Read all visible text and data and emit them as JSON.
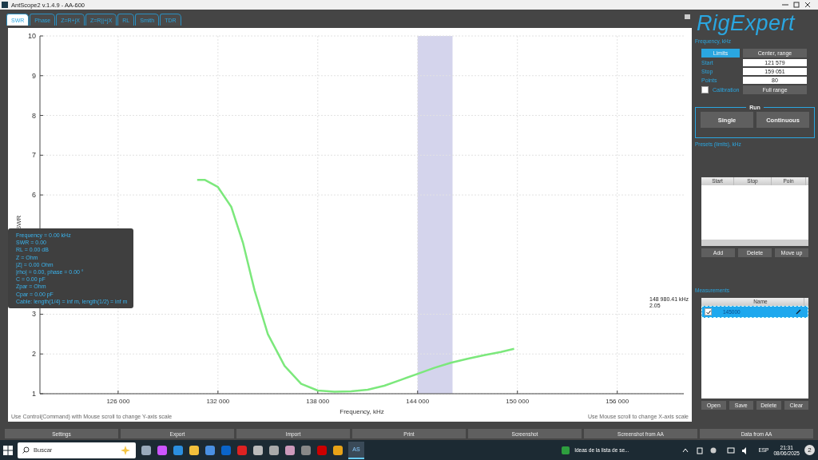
{
  "window": {
    "title": "AntScope2 v.1.4.9 - AA-600"
  },
  "tabs": [
    {
      "label": "SWR",
      "selected": true
    },
    {
      "label": "Phase",
      "selected": false
    },
    {
      "label": "Z=R+jX",
      "selected": false
    },
    {
      "label": "Z=R||+jX",
      "selected": false
    },
    {
      "label": "RL",
      "selected": false
    },
    {
      "label": "Smith",
      "selected": false
    },
    {
      "label": "TDR",
      "selected": false
    }
  ],
  "chart": {
    "chart_data": {
      "type": "line",
      "xlabel": "Frequency, kHz",
      "ylabel": "SWR",
      "xlim": [
        121300,
        160000
      ],
      "ylim": [
        1,
        10
      ],
      "xticks": [
        {
          "value": 126000,
          "label": "126 000"
        },
        {
          "value": 132000,
          "label": "132 000"
        },
        {
          "value": 138000,
          "label": "138 000"
        },
        {
          "value": 144000,
          "label": "144 000"
        },
        {
          "value": 150000,
          "label": "150 000"
        },
        {
          "value": 156000,
          "label": "156 000"
        }
      ],
      "yticks": [
        1,
        2,
        3,
        6,
        7,
        8,
        9,
        10
      ],
      "x": [
        130750,
        131200,
        132000,
        132800,
        133500,
        134200,
        135000,
        136000,
        137000,
        138000,
        139000,
        140000,
        141000,
        142000,
        143000,
        144000,
        145000,
        146000,
        147000,
        148000,
        149000,
        149800
      ],
      "series": [
        {
          "color": "#7ce87c",
          "values": [
            6.38,
            6.38,
            6.2,
            5.7,
            4.8,
            3.6,
            2.5,
            1.7,
            1.25,
            1.08,
            1.05,
            1.06,
            1.1,
            1.2,
            1.35,
            1.5,
            1.65,
            1.78,
            1.88,
            1.97,
            2.05,
            2.13
          ]
        }
      ],
      "grid": true,
      "bands": [
        {
          "axis": "x",
          "from": 144000,
          "to": 146100,
          "color": "#d4d4ec"
        }
      ]
    },
    "hints": [
      "Use Control(Command) with Mouse scroll to change Y-axis scale",
      "Use Mouse scroll to change X-axis scale"
    ],
    "cursor": {
      "frequency": "148 980.41 kHz",
      "value": "2.05"
    },
    "tooltip": [
      "Frequency = 0.00 kHz",
      "SWR = 0.00",
      "RL = 0.00 dB",
      "Z = Ohm",
      "|Z| = 0.00 Ohm",
      "|rho| = 0.00, phase = 0.00 °",
      "C = 0.00 pF",
      "Zpar = Ohm",
      "Cpar = 0.00 pF",
      "Cable: length(1/4) = inf m, length(1/2) = inf m"
    ]
  },
  "logo": "RigExpert",
  "frequency_panel": {
    "heading": "Frequency, kHz",
    "modes": [
      {
        "label": "Limits",
        "selected": true
      },
      {
        "label": "Center, range",
        "selected": false
      }
    ],
    "fields": [
      {
        "label": "Start",
        "value": "121 579"
      },
      {
        "label": "Stop",
        "value": "159 051"
      },
      {
        "label": "Points",
        "value": "80"
      }
    ],
    "calibration": {
      "label": "Calibration",
      "checked": false
    },
    "full_range": "Full range"
  },
  "run": {
    "title": "Run",
    "buttons": [
      "Single",
      "Continuous"
    ]
  },
  "presets": {
    "heading": "Presets (limits), kHz",
    "columns": [
      "Start",
      "Stop",
      "Poin"
    ],
    "buttons": [
      "Add",
      "Delete",
      "Move up"
    ]
  },
  "measurements": {
    "heading": "Measurements",
    "column": "Name",
    "rows": [
      {
        "name": "145000",
        "checked": true,
        "selected": true
      }
    ],
    "buttons": [
      "Open",
      "Save",
      "Delete",
      "Clear"
    ]
  },
  "bottom_buttons": [
    "Settings",
    "Export",
    "Import",
    "Print",
    "Screenshot",
    "Screenshot from AA",
    "Data from AA"
  ],
  "taskbar": {
    "search_placeholder": "Buscar",
    "notification": "Ideas de la lista de se...",
    "language": "ESP",
    "time": "21:31",
    "date": "08/06/2025",
    "badge": "2",
    "active_app": "AS"
  }
}
